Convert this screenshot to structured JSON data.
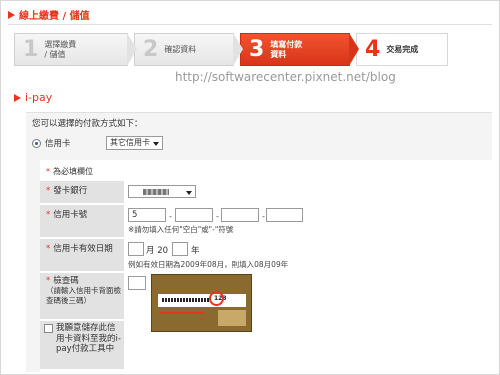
{
  "page_title": "線上繳費 / 儲值",
  "steps": [
    {
      "num": "1",
      "label_1": "選擇繳費",
      "label_2": "/ 儲值"
    },
    {
      "num": "2",
      "label_1": "確認資料",
      "label_2": ""
    },
    {
      "num": "3",
      "label_1": "填寫付款",
      "label_2": "資料"
    },
    {
      "num": "4",
      "label_1": "交易完成",
      "label_2": ""
    }
  ],
  "watermark": "http://softwarecenter.pixnet.net/blog",
  "section_title": "i-pay",
  "payment": {
    "heading": "您可以選擇的付款方式如下：",
    "method_label": "信用卡",
    "method_select": "其它信用卡"
  },
  "form": {
    "required_note": "為必填欄位",
    "bank_label": "發卡銀行",
    "card_no_label": "信用卡號",
    "card_no_value": "5",
    "card_no_note": "※請勿填入任何\"空白\"或\"-\"符號",
    "expiry_label": "信用卡有效日期",
    "month_unit": "月 20",
    "year_unit": "年",
    "expiry_note": "例如有效日期為2009年08月，則填入08月09年",
    "cvv_label": "檢查碼",
    "cvv_hint": "（請輸入信用卡背面檢查碼後三碼）",
    "cvv_card_text": "123",
    "save_label": "我願意儲存此信用卡資料至我的i-pay付款工具中"
  },
  "colors": {
    "accent": "#e8341c",
    "label_bg": "#e2e2e2"
  }
}
